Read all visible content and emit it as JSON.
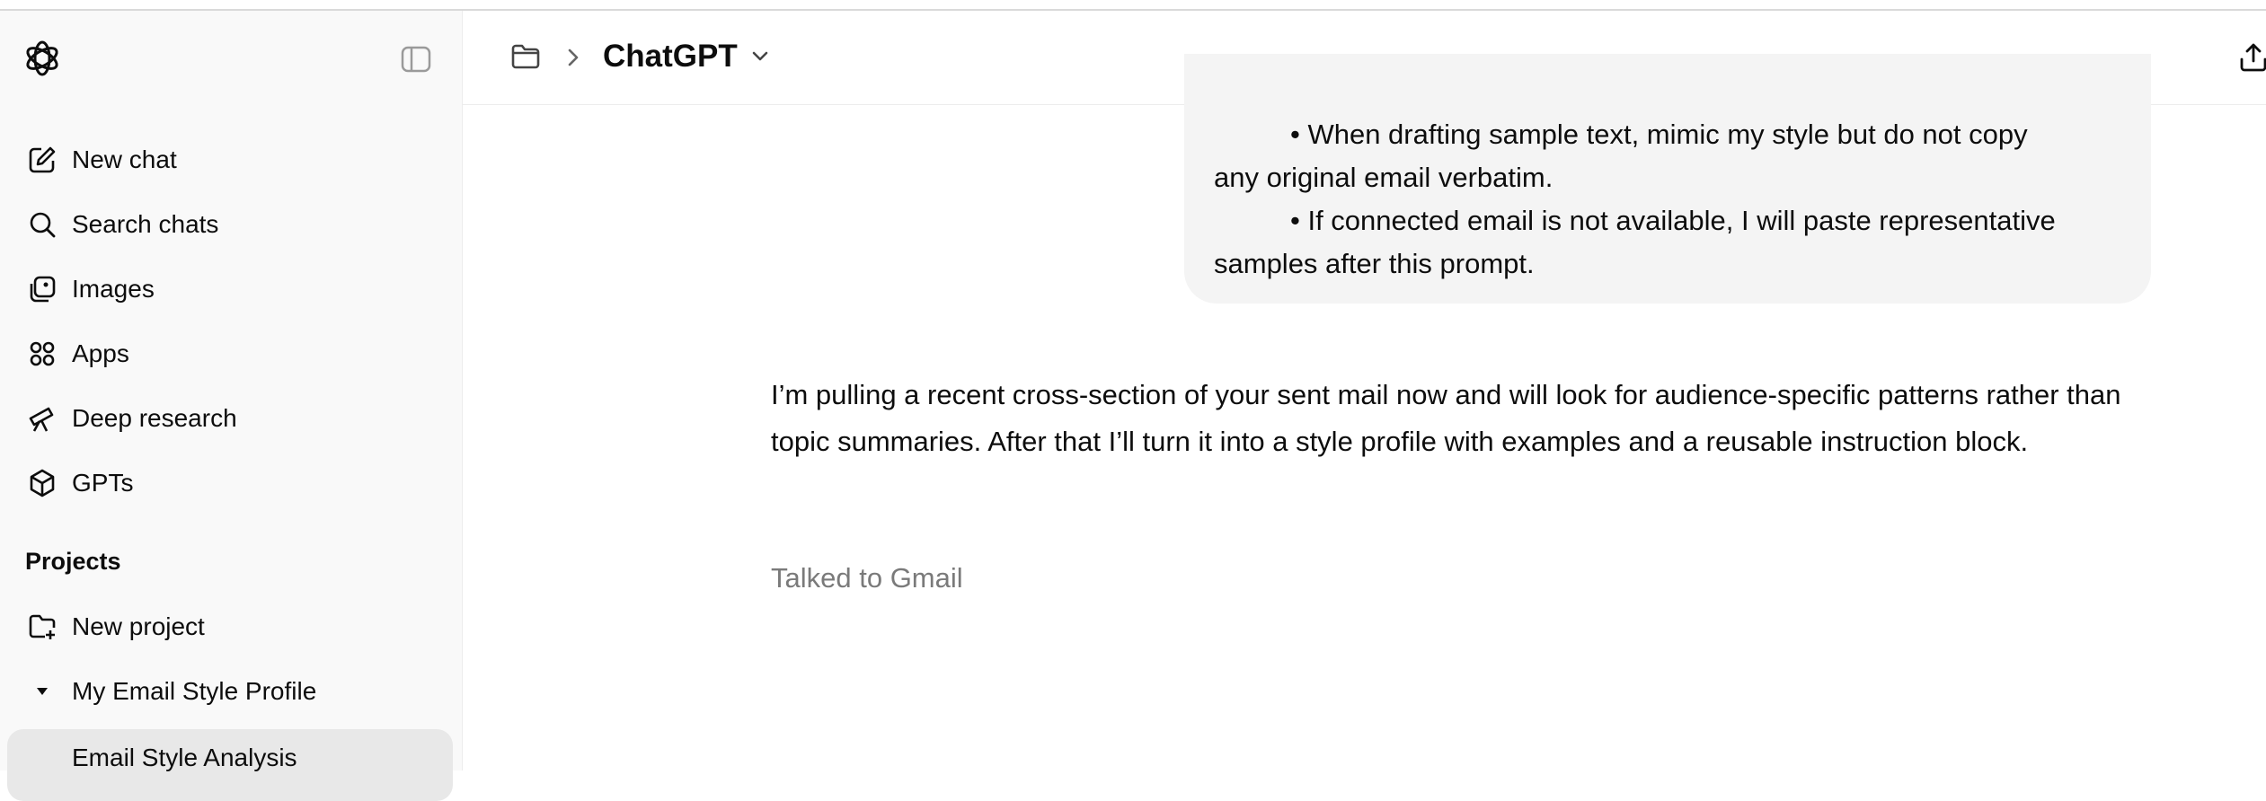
{
  "sidebar": {
    "nav": [
      {
        "label": "New chat",
        "icon": "pencil-square-icon"
      },
      {
        "label": "Search chats",
        "icon": "search-icon"
      },
      {
        "label": "Images",
        "icon": "images-icon"
      },
      {
        "label": "Apps",
        "icon": "apps-grid-icon"
      },
      {
        "label": "Deep research",
        "icon": "telescope-icon"
      },
      {
        "label": "GPTs",
        "icon": "cube-icon"
      }
    ],
    "projects_title": "Projects",
    "projects": [
      {
        "label": "New project",
        "icon": "folder-plus-icon"
      },
      {
        "label": "My Email Style Profile",
        "icon": "caret-down-icon"
      }
    ],
    "active_chat": "Email Style Analysis"
  },
  "header": {
    "title": "ChatGPT"
  },
  "conversation": {
    "user_message_lines": [
      "• When drafting sample text, mimic my style but do not copy",
      "any original email verbatim.",
      "• If connected email is not available, I will paste representative",
      "samples after this prompt."
    ],
    "assistant_message": "I’m pulling a recent cross-section of your sent mail now and will look for audience-specific patterns rather than topic summaries. After that I’ll turn it into a style profile with examples and a reusable instruction block.",
    "tool_status": "Talked to Gmail"
  }
}
